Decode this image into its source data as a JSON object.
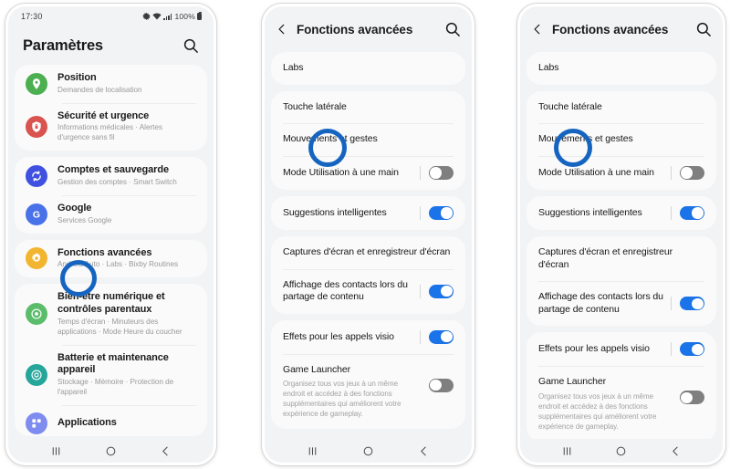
{
  "theme": {
    "accent_blue": "#1a73e8",
    "annotation_blue": "#1565c0",
    "screen_bg": "#f2f3f5",
    "card_bg": "#fafafa",
    "toggle_off": "#7f7f7f"
  },
  "phone1": {
    "statusbar": {
      "time": "17:30",
      "battery_percent": "100%",
      "icons": [
        "nfc-icon",
        "wifi-icon",
        "signal-bars-icon",
        "battery-icon"
      ]
    },
    "appbar": {
      "title": "Paramètres",
      "search_icon": "search-icon"
    },
    "items": [
      {
        "icon": "location-pin-icon",
        "color": "#4caf50",
        "title": "Position",
        "subtitle": "Demandes de localisation"
      },
      {
        "icon": "shield-lock-icon",
        "color": "#d9534f",
        "title": "Sécurité et urgence",
        "subtitle": "Informations médicales · Alertes d'urgence sans fil"
      },
      {
        "icon": "sync-accounts-icon",
        "color": "#3f51e0",
        "title": "Comptes et sauvegarde",
        "subtitle": "Gestion des comptes · Smart Switch"
      },
      {
        "icon": "google-g-icon",
        "color": "#4a72e8",
        "title": "Google",
        "subtitle": "Services Google"
      },
      {
        "icon": "gear-advanced-icon",
        "color": "#f2b530",
        "title": "Fonctions avancées",
        "subtitle": "Android Auto · Labs · Bixby Routines"
      },
      {
        "icon": "digital-wellbeing-icon",
        "color": "#5bbd6b",
        "title": "Bien-être numérique et contrôles parentaux",
        "subtitle": "Temps d'écran · Minuteurs des applications · Mode Heure du coucher"
      },
      {
        "icon": "battery-care-icon",
        "color": "#26a69a",
        "title": "Batterie et maintenance appareil",
        "subtitle": "Stockage · Mémoire · Protection de l'appareil"
      },
      {
        "icon": "apps-icon",
        "color": "#7e8cf0",
        "title": "Applications",
        "subtitle": ""
      }
    ],
    "navbar": [
      "recents-icon",
      "home-icon",
      "back-icon"
    ]
  },
  "phone2": {
    "appbar": {
      "back_icon": "back-chevron-icon",
      "title": "Fonctions avancées",
      "search_icon": "search-icon"
    },
    "groups": [
      {
        "rows": [
          {
            "title": "Labs",
            "toggle": null
          }
        ]
      },
      {
        "rows": [
          {
            "title": "Touche latérale",
            "toggle": null
          },
          {
            "title": "Mouvements et gestes",
            "toggle": null
          },
          {
            "title": "Mode Utilisation à une main",
            "toggle": "off"
          }
        ]
      },
      {
        "rows": [
          {
            "title": "Suggestions intelligentes",
            "toggle": "on"
          }
        ]
      },
      {
        "rows": [
          {
            "title": "Captures d'écran et enregistreur d'écran",
            "toggle": null
          },
          {
            "title": "Affichage des contacts lors du partage de contenu",
            "toggle": "on"
          }
        ]
      },
      {
        "rows": [
          {
            "title": "Effets pour les appels visio",
            "toggle": "on"
          },
          {
            "title": "Game Launcher",
            "subtitle": "Organisez tous vos jeux à un même endroit et accédez à des fonctions supplémentaires qui améliorent votre expérience de gameplay.",
            "toggle": "off"
          }
        ]
      }
    ],
    "navbar": [
      "recents-icon",
      "home-icon",
      "back-icon"
    ],
    "annotation": {
      "target": "Mouvements et gestes"
    }
  },
  "phone3": {
    "appbar": {
      "back_icon": "back-chevron-icon",
      "title": "Fonctions avancées",
      "search_icon": "search-icon"
    },
    "groups": [
      {
        "rows": [
          {
            "title": "Labs",
            "toggle": null
          }
        ]
      },
      {
        "rows": [
          {
            "title": "Touche latérale",
            "toggle": null
          },
          {
            "title": "Mouvements et gestes",
            "toggle": null
          },
          {
            "title": "Mode Utilisation à une main",
            "toggle": "off"
          }
        ]
      },
      {
        "rows": [
          {
            "title": "Suggestions intelligentes",
            "toggle": "on"
          }
        ]
      },
      {
        "rows": [
          {
            "title": "Captures d'écran et enregistreur d'écran",
            "toggle": null
          },
          {
            "title": "Affichage des contacts lors du partage de contenu",
            "toggle": "on"
          }
        ]
      },
      {
        "rows": [
          {
            "title": "Effets pour les appels visio",
            "toggle": "on"
          },
          {
            "title": "Game Launcher",
            "subtitle": "Organisez tous vos jeux à un même endroit et accédez à des fonctions supplémentaires qui améliorent votre expérience de gameplay.",
            "toggle": "off"
          }
        ]
      }
    ],
    "navbar": [
      "recents-icon",
      "home-icon",
      "back-icon"
    ],
    "annotation": {
      "target": "Mouvements et gestes"
    }
  }
}
